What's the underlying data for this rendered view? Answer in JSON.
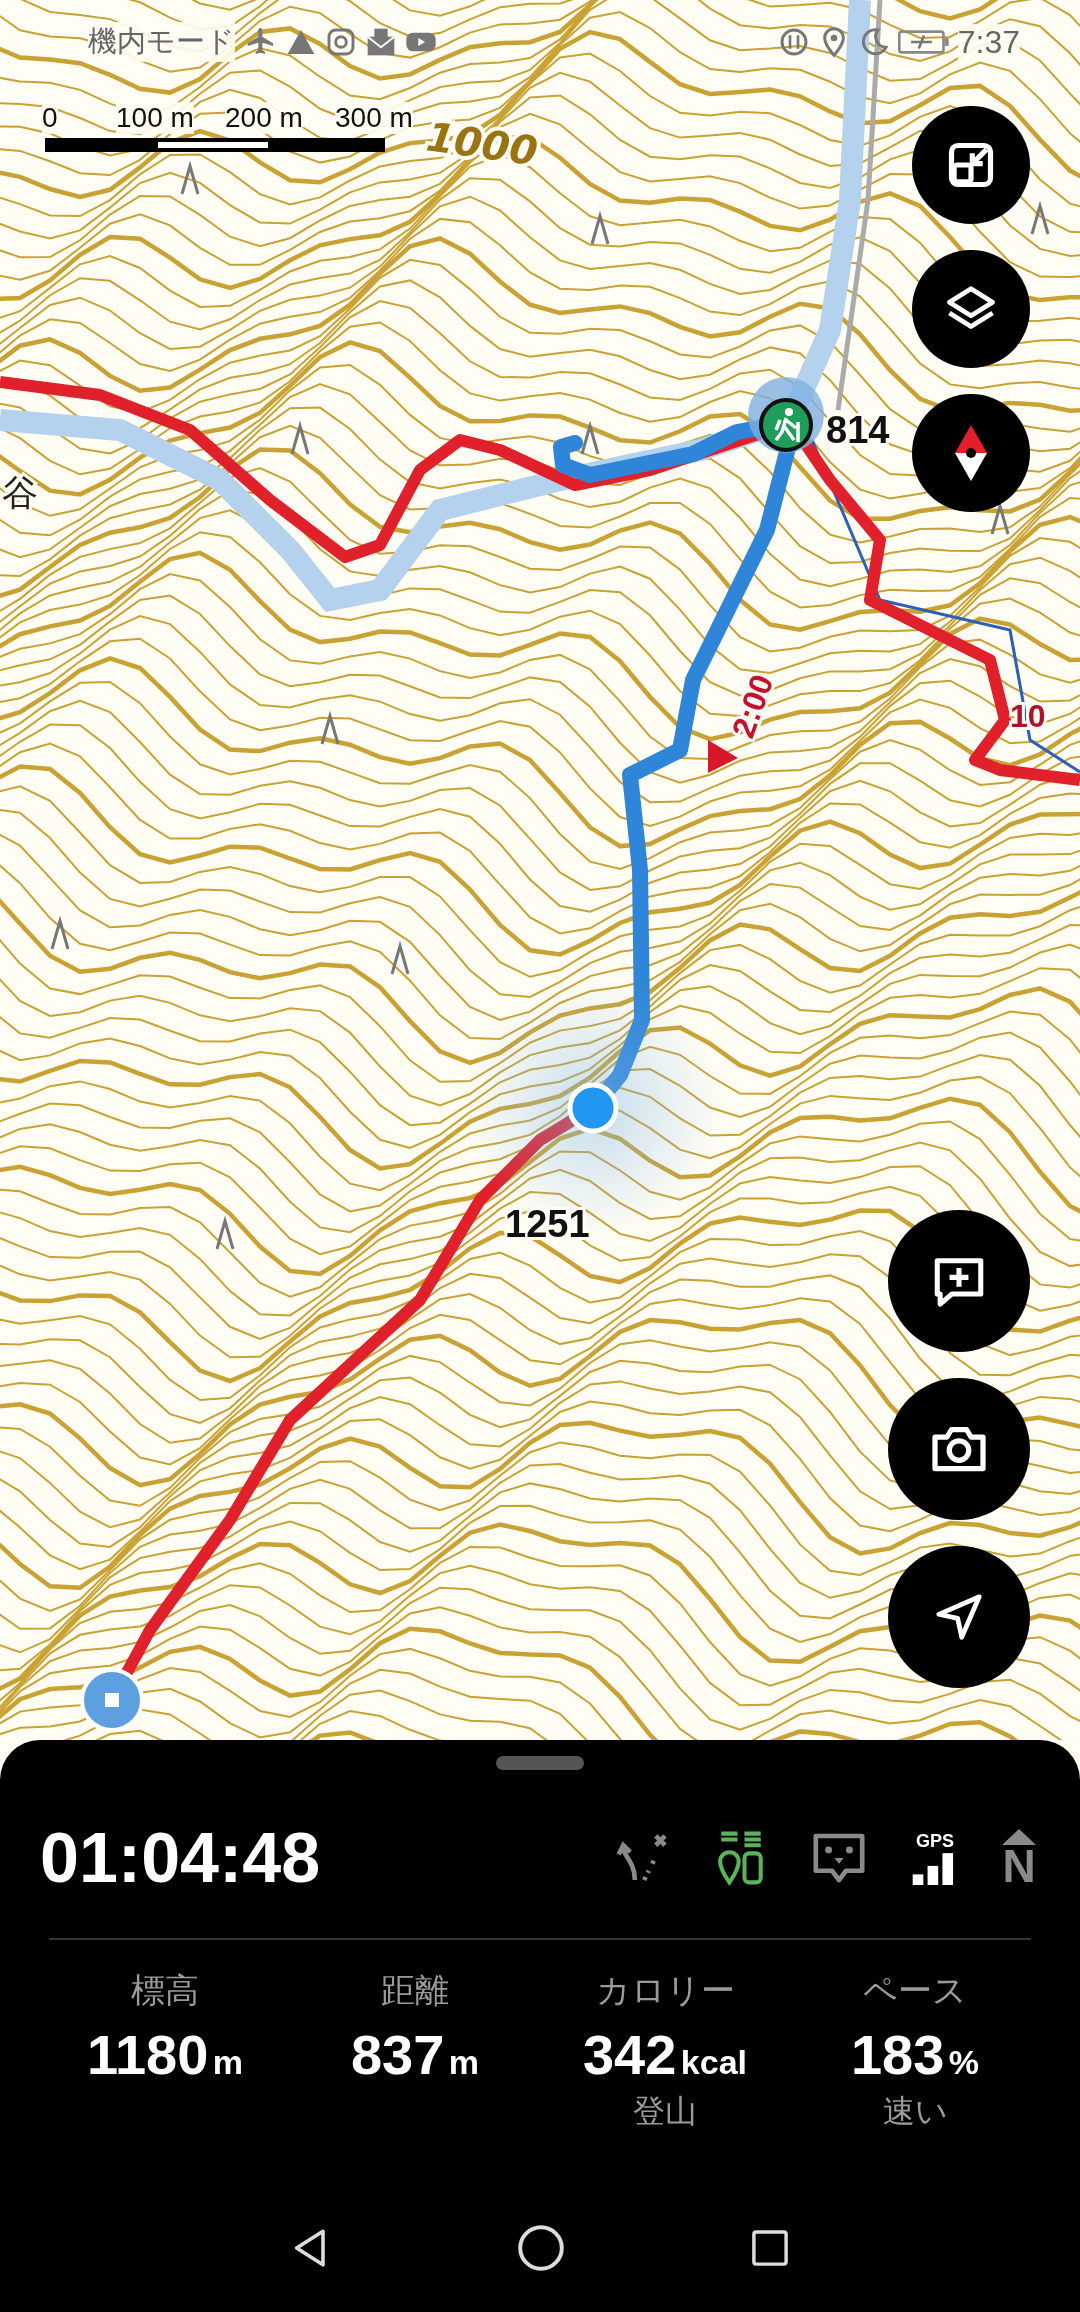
{
  "status_bar": {
    "mode": "機内モード",
    "time": "7:37"
  },
  "scale_bar": {
    "ticks": [
      "0",
      "100 m",
      "200 m",
      "300 m"
    ]
  },
  "map": {
    "labels": [
      {
        "kind": "contour",
        "text": "1000"
      },
      {
        "kind": "place",
        "text": "谷"
      },
      {
        "kind": "elevation",
        "text": "814"
      },
      {
        "kind": "time",
        "text": "2:00"
      },
      {
        "kind": "route",
        "text": "10"
      },
      {
        "kind": "elevation",
        "text": "1251"
      }
    ]
  },
  "panel": {
    "elapsed": "01:04:48",
    "indicators": [
      {
        "kind": "route-off",
        "active": false
      },
      {
        "kind": "markers",
        "active": true
      },
      {
        "kind": "chat",
        "active": false
      },
      {
        "kind": "gps",
        "text": "GPS",
        "active": false
      },
      {
        "kind": "north",
        "text": "N",
        "active": false
      }
    ],
    "stats": [
      {
        "label": "標高",
        "value": "1180",
        "unit": "m"
      },
      {
        "label": "距離",
        "value": "837",
        "unit": "m"
      },
      {
        "label": "カロリー",
        "value": "342",
        "unit": "kcal",
        "note": "登山"
      },
      {
        "label": "ペース",
        "value": "183",
        "unit": "%",
        "note": "速い"
      }
    ]
  }
}
